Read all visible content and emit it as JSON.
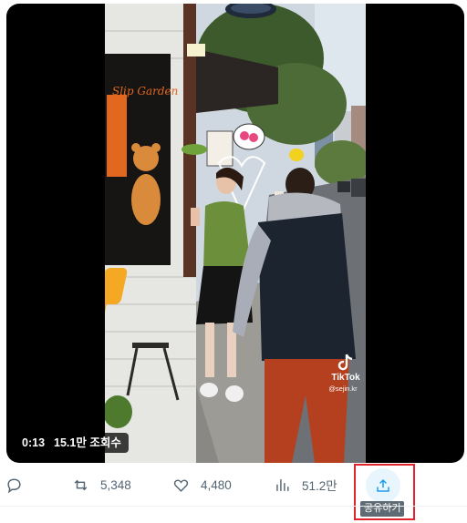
{
  "video": {
    "time": "0:13",
    "views": "15.1만 조회수",
    "watermark_name": "TikTok",
    "watermark_handle": "@sejin.kr",
    "sign_text": "Slip Garden"
  },
  "actions": {
    "reply_icon": "speech-bubble-icon",
    "repost_count": "5,348",
    "like_count": "4,480",
    "view_count": "51.2만",
    "share_tooltip": "공유하기"
  },
  "colors": {
    "accent": "#1d9bf0",
    "highlight_box": "#e0242b",
    "icon_gray": "#536471"
  }
}
